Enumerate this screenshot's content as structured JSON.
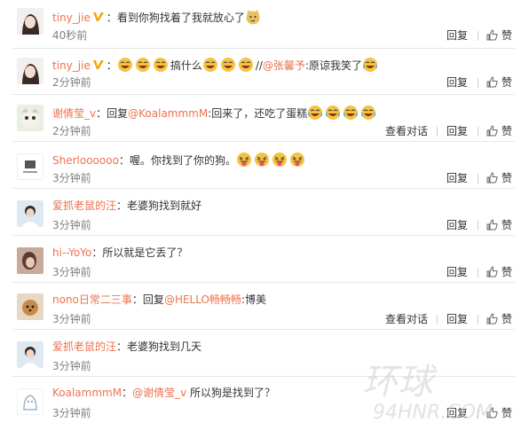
{
  "comments": [
    {
      "user": "tiny_jie",
      "verified": true,
      "colon": "：",
      "segments": [
        {
          "t": "text",
          "v": "看到你狗找着了我就放心了"
        }
      ],
      "emoji_after": [
        "doge"
      ],
      "time": "40秒前",
      "show_convo": false
    },
    {
      "user": "tiny_jie",
      "verified": true,
      "colon": "：",
      "time": "2分钟前",
      "show_convo": false,
      "pre_emoji": [
        "laugh",
        "laugh",
        "laugh"
      ],
      "mid_text": "搞什么",
      "mid_emoji": [
        "laugh",
        "laugh",
        "laugh"
      ],
      "slashes": "//",
      "mention": "@张馨予",
      "mention_text": ":原谅我笑了",
      "end_emoji": [
        "cry-laugh"
      ]
    },
    {
      "user": "谢倩莹_v",
      "verified": false,
      "colon": "：",
      "reply_word": "回复",
      "mention": "@KoalammmM",
      "after": ":回来了，还吃了蛋糕",
      "end_emoji": [
        "cry-laugh",
        "cry-laugh",
        "cry-laugh",
        "cry-laugh"
      ],
      "time": "2分钟前",
      "show_convo": true
    },
    {
      "user": "Sherloooooo",
      "verified": false,
      "colon": "：",
      "text": "喔。你找到了你的狗。",
      "end_emoji": [
        "tongue",
        "tongue",
        "tongue",
        "tongue"
      ],
      "time": "3分钟前",
      "show_convo": false
    },
    {
      "user": "爱抓老鼠的汪",
      "verified": false,
      "colon": "：",
      "text": "老婆狗找到就好",
      "time": "3分钟前",
      "show_convo": false
    },
    {
      "user": "hi--YoYo",
      "verified": false,
      "colon": "：",
      "text": "所以就是它丢了？",
      "time": "3分钟前",
      "show_convo": false
    },
    {
      "user": "nono日常二三事",
      "verified": false,
      "colon": "：",
      "reply_word": "回复",
      "mention": "@HELLO畅畅畅",
      "after": ":博美",
      "time": "3分钟前",
      "show_convo": true
    },
    {
      "user": "爱抓老鼠的汪",
      "verified": false,
      "colon": "：",
      "text": "老婆狗找到几天",
      "time": "3分钟前",
      "show_convo": false
    },
    {
      "user": "KoalammmM",
      "verified": false,
      "colon": "：",
      "mention": "@谢倩莹_v",
      "after": " 所以狗是找到了？",
      "time": "3分钟前",
      "show_convo": false
    }
  ],
  "actions": {
    "reply": "回复",
    "like": "赞",
    "view_convo": "查看对话"
  },
  "watermark": "94HNR.COM",
  "colors": {
    "name": "#eb7350",
    "text": "#333333",
    "time": "#808080",
    "divider": "#e8e8e8",
    "emoji": "#f5c342"
  }
}
